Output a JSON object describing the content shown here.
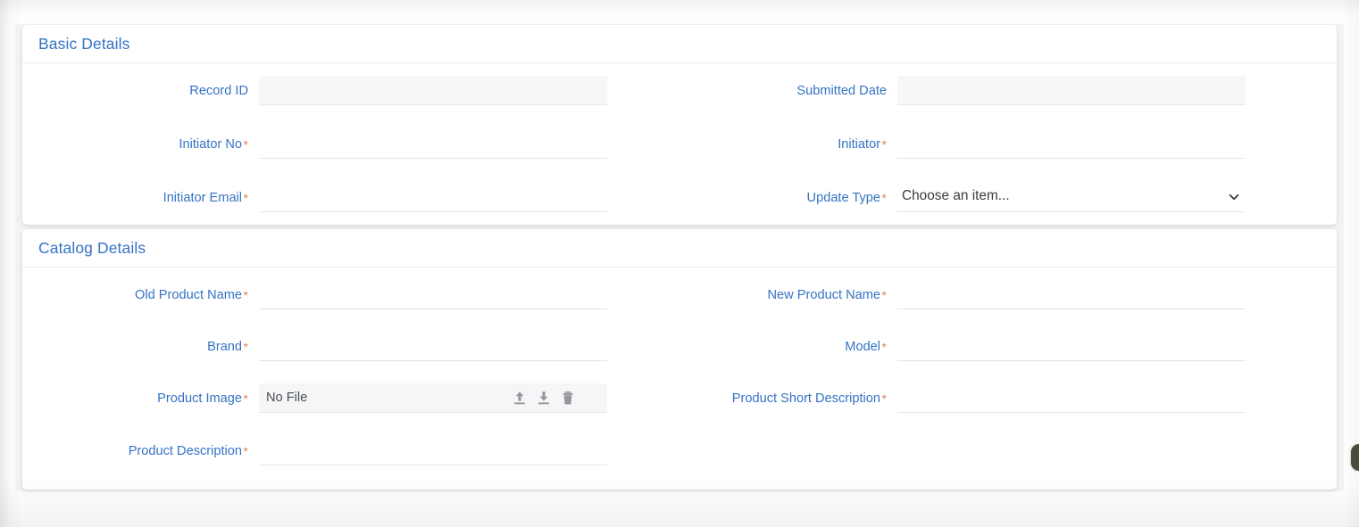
{
  "form": {
    "sections": [
      {
        "id": "basic-details",
        "title": "Basic Details",
        "fields": [
          {
            "label": "Record ID",
            "required": false,
            "type": "text",
            "value": "",
            "state": "disabled",
            "column": "left",
            "row": 0
          },
          {
            "label": "Submitted Date",
            "required": false,
            "type": "text",
            "value": "",
            "state": "disabled",
            "column": "right",
            "row": 0
          },
          {
            "label": "Initiator No",
            "required": true,
            "type": "text",
            "value": "",
            "state": "enabled",
            "column": "left",
            "row": 1
          },
          {
            "label": "Initiator",
            "required": true,
            "type": "text",
            "value": "",
            "state": "enabled",
            "column": "right",
            "row": 1
          },
          {
            "label": "Initiator Email",
            "required": true,
            "type": "text",
            "value": "",
            "state": "enabled",
            "column": "left",
            "row": 2
          },
          {
            "label": "Update Type",
            "required": true,
            "type": "select",
            "value": "Choose an item...",
            "state": "enabled",
            "column": "right",
            "row": 2
          }
        ]
      },
      {
        "id": "catalog-details",
        "title": "Catalog Details",
        "fields": [
          {
            "label": "Old Product Name",
            "required": true,
            "type": "text",
            "value": "",
            "state": "enabled",
            "column": "left",
            "row": 0
          },
          {
            "label": "New Product Name",
            "required": true,
            "type": "text",
            "value": "",
            "state": "enabled",
            "column": "right",
            "row": 0
          },
          {
            "label": "Brand",
            "required": true,
            "type": "text",
            "value": "",
            "state": "enabled",
            "column": "left",
            "row": 1
          },
          {
            "label": "Model",
            "required": true,
            "type": "text",
            "value": "",
            "state": "enabled",
            "column": "right",
            "row": 1
          },
          {
            "label": "Product Image",
            "required": true,
            "type": "file",
            "value": "No File",
            "state": "enabled",
            "column": "left",
            "row": 2
          },
          {
            "label": "Product Short Description",
            "required": true,
            "type": "text",
            "value": "",
            "state": "enabled",
            "column": "right",
            "row": 2
          },
          {
            "label": "Product Description",
            "required": true,
            "type": "text",
            "value": "",
            "state": "enabled",
            "column": "left",
            "row": 3
          }
        ]
      }
    ],
    "required_marker": "*",
    "file_field": {
      "empty_text": "No File",
      "actions": [
        {
          "name": "upload-icon",
          "title": "Upload"
        },
        {
          "name": "download-icon",
          "title": "Download"
        },
        {
          "name": "delete-icon",
          "title": "Delete"
        }
      ]
    },
    "select_placeholder": "Choose an item...",
    "input_placeholder": ""
  },
  "colors": {
    "label": "#3573c4",
    "section_title": "#3573c4",
    "required": "#e08263",
    "field_underline": "#e3e4e7",
    "disabled_fill": "#f6f7f8",
    "card_bg": "#ffffff",
    "page_bg": "#f4f5f7",
    "edge_tab": "#4a4f3c"
  }
}
